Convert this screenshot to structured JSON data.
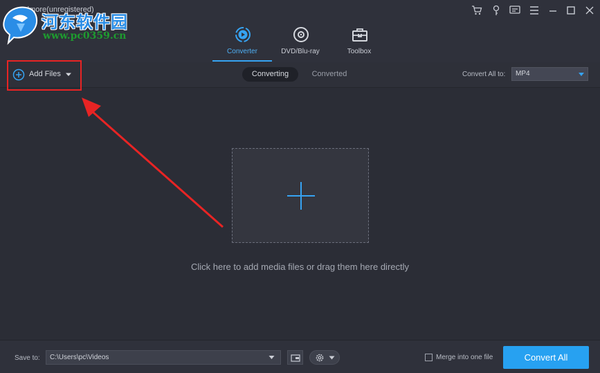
{
  "window": {
    "title": "dmore(unregistered)",
    "icons": [
      "cart-icon",
      "key-icon",
      "feedback-icon",
      "menu-icon",
      "minimize-icon",
      "maximize-icon",
      "close-icon"
    ]
  },
  "watermark": {
    "text_cn": "河东软件园",
    "url": "www.pc0359.cn"
  },
  "main_tabs": [
    {
      "label": "Converter",
      "icon": "converter-icon",
      "active": true
    },
    {
      "label": "DVD/Blu-ray",
      "icon": "disc-icon",
      "active": false
    },
    {
      "label": "Toolbox",
      "icon": "toolbox-icon",
      "active": false
    }
  ],
  "toolbar": {
    "add_files_label": "Add Files",
    "sub_tabs": [
      {
        "label": "Converting",
        "active": true
      },
      {
        "label": "Converted",
        "active": false
      }
    ],
    "convert_all_to_label": "Convert All to:",
    "format_value": "MP4"
  },
  "content": {
    "drop_hint": "Click here to add media files or drag them here directly"
  },
  "bottom": {
    "save_to_label": "Save to:",
    "save_path": "C:\\Users\\pc\\Videos",
    "merge_label": "Merge into one file",
    "convert_all_label": "Convert All"
  },
  "colors": {
    "accent": "#27a1f1",
    "highlight": "#e82424",
    "background": "#2b2d36"
  }
}
